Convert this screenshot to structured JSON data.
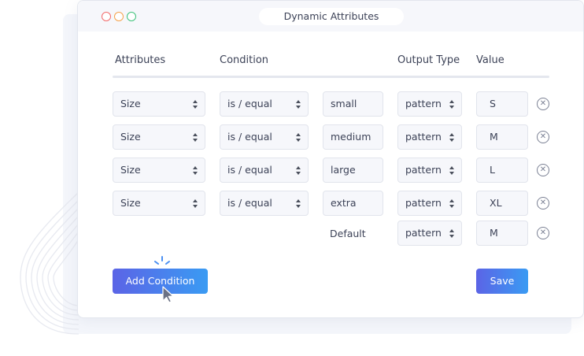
{
  "window": {
    "title": "Dynamic Attributes"
  },
  "headers": {
    "attributes": "Attributes",
    "condition": "Condition",
    "output_type": "Output Type",
    "value": "Value"
  },
  "rows": [
    {
      "attribute": "Size",
      "condition": "is / equal",
      "match": "small",
      "output": "pattern",
      "value": "S"
    },
    {
      "attribute": "Size",
      "condition": "is / equal",
      "match": "medium",
      "output": "pattern",
      "value": "M"
    },
    {
      "attribute": "Size",
      "condition": "is / equal",
      "match": "large",
      "output": "pattern",
      "value": "L"
    },
    {
      "attribute": "Size",
      "condition": "is / equal",
      "match": "extra",
      "output": "pattern",
      "value": "XL"
    }
  ],
  "default_row": {
    "label": "Default",
    "output": "pattern",
    "value": "M"
  },
  "buttons": {
    "add_condition": "Add Condition",
    "save": "Save"
  },
  "icons": {
    "remove": "remove-circle-icon",
    "sort": "sort-arrows-icon",
    "cursor": "mouse-pointer-icon",
    "click": "click-burst-icon"
  },
  "colors": {
    "accent_start": "#5b64e6",
    "accent_end": "#3a9bf3",
    "dot_red": "#f26b6b",
    "dot_orange": "#f5a24a",
    "dot_green": "#3ec27a"
  }
}
